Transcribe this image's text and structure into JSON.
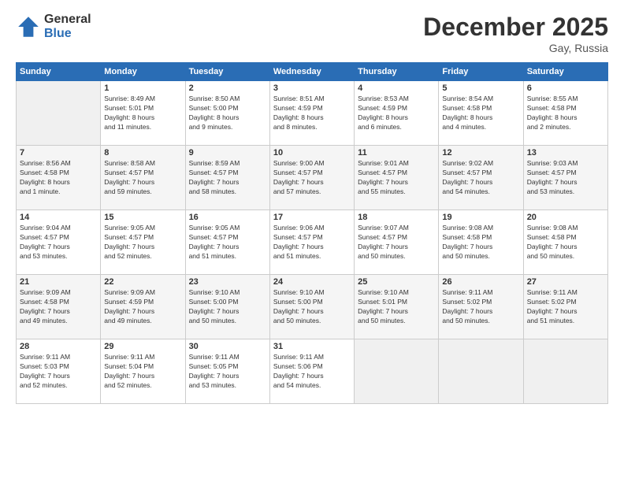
{
  "logo": {
    "general": "General",
    "blue": "Blue"
  },
  "header": {
    "title": "December 2025",
    "location": "Gay, Russia"
  },
  "weekdays": [
    "Sunday",
    "Monday",
    "Tuesday",
    "Wednesday",
    "Thursday",
    "Friday",
    "Saturday"
  ],
  "weeks": [
    [
      {
        "day": "",
        "info": ""
      },
      {
        "day": "1",
        "info": "Sunrise: 8:49 AM\nSunset: 5:01 PM\nDaylight: 8 hours\nand 11 minutes."
      },
      {
        "day": "2",
        "info": "Sunrise: 8:50 AM\nSunset: 5:00 PM\nDaylight: 8 hours\nand 9 minutes."
      },
      {
        "day": "3",
        "info": "Sunrise: 8:51 AM\nSunset: 4:59 PM\nDaylight: 8 hours\nand 8 minutes."
      },
      {
        "day": "4",
        "info": "Sunrise: 8:53 AM\nSunset: 4:59 PM\nDaylight: 8 hours\nand 6 minutes."
      },
      {
        "day": "5",
        "info": "Sunrise: 8:54 AM\nSunset: 4:58 PM\nDaylight: 8 hours\nand 4 minutes."
      },
      {
        "day": "6",
        "info": "Sunrise: 8:55 AM\nSunset: 4:58 PM\nDaylight: 8 hours\nand 2 minutes."
      }
    ],
    [
      {
        "day": "7",
        "info": "Sunrise: 8:56 AM\nSunset: 4:58 PM\nDaylight: 8 hours\nand 1 minute."
      },
      {
        "day": "8",
        "info": "Sunrise: 8:58 AM\nSunset: 4:57 PM\nDaylight: 7 hours\nand 59 minutes."
      },
      {
        "day": "9",
        "info": "Sunrise: 8:59 AM\nSunset: 4:57 PM\nDaylight: 7 hours\nand 58 minutes."
      },
      {
        "day": "10",
        "info": "Sunrise: 9:00 AM\nSunset: 4:57 PM\nDaylight: 7 hours\nand 57 minutes."
      },
      {
        "day": "11",
        "info": "Sunrise: 9:01 AM\nSunset: 4:57 PM\nDaylight: 7 hours\nand 55 minutes."
      },
      {
        "day": "12",
        "info": "Sunrise: 9:02 AM\nSunset: 4:57 PM\nDaylight: 7 hours\nand 54 minutes."
      },
      {
        "day": "13",
        "info": "Sunrise: 9:03 AM\nSunset: 4:57 PM\nDaylight: 7 hours\nand 53 minutes."
      }
    ],
    [
      {
        "day": "14",
        "info": "Sunrise: 9:04 AM\nSunset: 4:57 PM\nDaylight: 7 hours\nand 53 minutes."
      },
      {
        "day": "15",
        "info": "Sunrise: 9:05 AM\nSunset: 4:57 PM\nDaylight: 7 hours\nand 52 minutes."
      },
      {
        "day": "16",
        "info": "Sunrise: 9:05 AM\nSunset: 4:57 PM\nDaylight: 7 hours\nand 51 minutes."
      },
      {
        "day": "17",
        "info": "Sunrise: 9:06 AM\nSunset: 4:57 PM\nDaylight: 7 hours\nand 51 minutes."
      },
      {
        "day": "18",
        "info": "Sunrise: 9:07 AM\nSunset: 4:57 PM\nDaylight: 7 hours\nand 50 minutes."
      },
      {
        "day": "19",
        "info": "Sunrise: 9:08 AM\nSunset: 4:58 PM\nDaylight: 7 hours\nand 50 minutes."
      },
      {
        "day": "20",
        "info": "Sunrise: 9:08 AM\nSunset: 4:58 PM\nDaylight: 7 hours\nand 50 minutes."
      }
    ],
    [
      {
        "day": "21",
        "info": "Sunrise: 9:09 AM\nSunset: 4:58 PM\nDaylight: 7 hours\nand 49 minutes."
      },
      {
        "day": "22",
        "info": "Sunrise: 9:09 AM\nSunset: 4:59 PM\nDaylight: 7 hours\nand 49 minutes."
      },
      {
        "day": "23",
        "info": "Sunrise: 9:10 AM\nSunset: 5:00 PM\nDaylight: 7 hours\nand 50 minutes."
      },
      {
        "day": "24",
        "info": "Sunrise: 9:10 AM\nSunset: 5:00 PM\nDaylight: 7 hours\nand 50 minutes."
      },
      {
        "day": "25",
        "info": "Sunrise: 9:10 AM\nSunset: 5:01 PM\nDaylight: 7 hours\nand 50 minutes."
      },
      {
        "day": "26",
        "info": "Sunrise: 9:11 AM\nSunset: 5:02 PM\nDaylight: 7 hours\nand 50 minutes."
      },
      {
        "day": "27",
        "info": "Sunrise: 9:11 AM\nSunset: 5:02 PM\nDaylight: 7 hours\nand 51 minutes."
      }
    ],
    [
      {
        "day": "28",
        "info": "Sunrise: 9:11 AM\nSunset: 5:03 PM\nDaylight: 7 hours\nand 52 minutes."
      },
      {
        "day": "29",
        "info": "Sunrise: 9:11 AM\nSunset: 5:04 PM\nDaylight: 7 hours\nand 52 minutes."
      },
      {
        "day": "30",
        "info": "Sunrise: 9:11 AM\nSunset: 5:05 PM\nDaylight: 7 hours\nand 53 minutes."
      },
      {
        "day": "31",
        "info": "Sunrise: 9:11 AM\nSunset: 5:06 PM\nDaylight: 7 hours\nand 54 minutes."
      },
      {
        "day": "",
        "info": ""
      },
      {
        "day": "",
        "info": ""
      },
      {
        "day": "",
        "info": ""
      }
    ]
  ]
}
